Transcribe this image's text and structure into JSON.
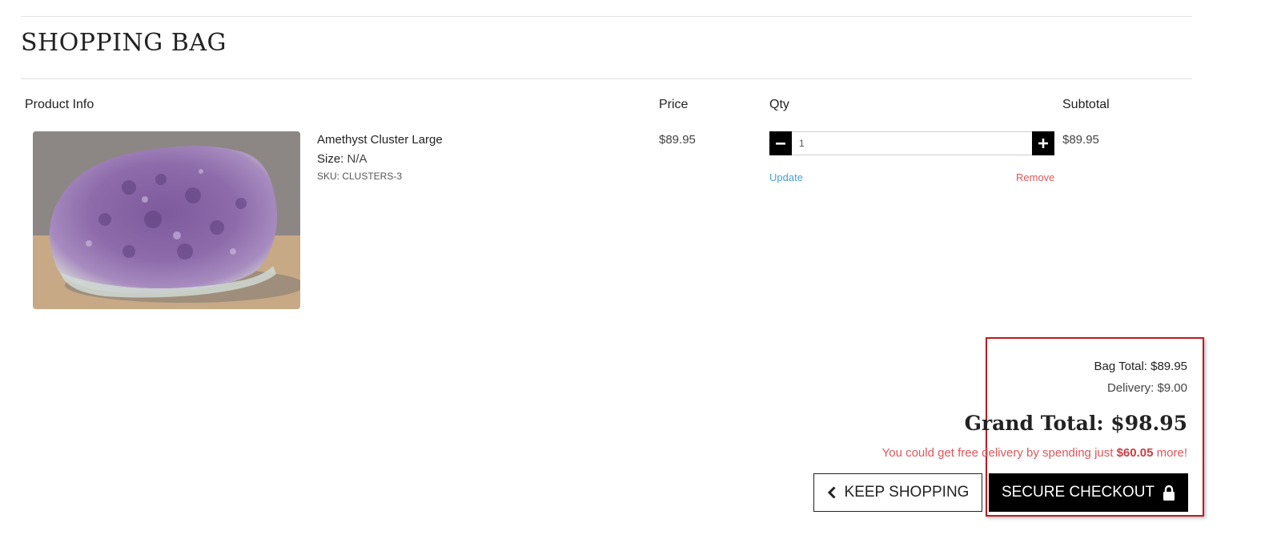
{
  "page": {
    "title": "SHOPPING BAG"
  },
  "table": {
    "headers": {
      "product": "Product Info",
      "price": "Price",
      "qty": "Qty",
      "subtotal": "Subtotal"
    }
  },
  "item": {
    "name": "Amethyst Cluster Large",
    "size_label": "Size:",
    "size_value": "N/A",
    "sku": "SKU: CLUSTERS-3",
    "price": "$89.95",
    "quantity": "1",
    "subtotal": "$89.95",
    "update_label": "Update",
    "remove_label": "Remove",
    "image_icon": "amethyst-crystal-photo"
  },
  "summary": {
    "bag_total": "Bag Total: $89.95",
    "delivery": "Delivery: $9.00",
    "grand_total": "Grand Total: $98.95",
    "free_delivery_prefix": "You could get free delivery by spending just",
    "free_delivery_amount": "$60.05",
    "free_delivery_suffix": "more!"
  },
  "actions": {
    "keep_shopping": "KEEP SHOPPING",
    "keep_shopping_icon": "chevron-left-icon",
    "secure_checkout": "SECURE CHECKOUT",
    "secure_checkout_icon": "lock-icon"
  },
  "colors": {
    "accent_red": "#c2191f",
    "link_blue": "#4a9fd6",
    "remove_red": "#e2555a",
    "button_black": "#000000"
  }
}
